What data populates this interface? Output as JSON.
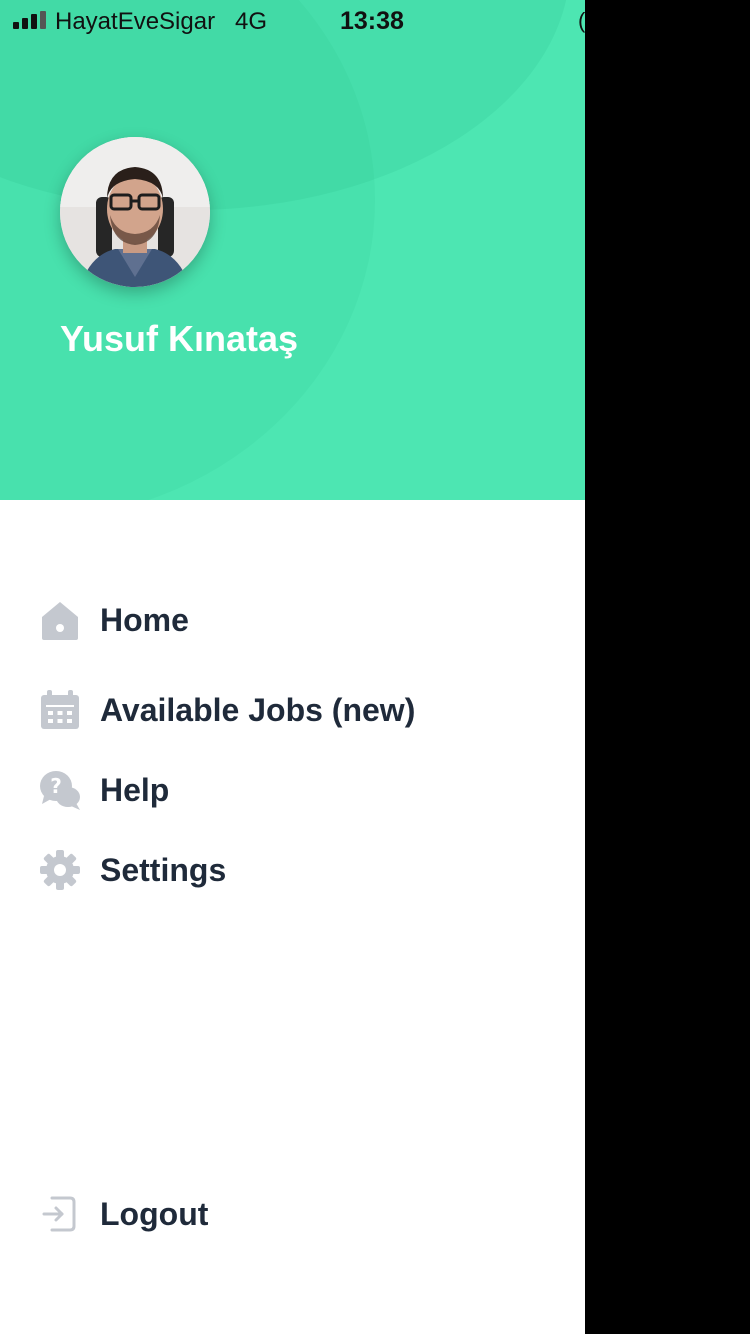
{
  "status_bar": {
    "carrier": "HayatEveSigar",
    "network": "4G",
    "time": "13:38"
  },
  "profile": {
    "name": "Yusuf Kınataş",
    "avatar_icon": "user-photo"
  },
  "menu": {
    "items": [
      {
        "label": "Home",
        "icon": "home-icon"
      },
      {
        "label": "Available Jobs (new)",
        "icon": "calendar-icon"
      },
      {
        "label": "Help",
        "icon": "help-chat-icon"
      },
      {
        "label": "Settings",
        "icon": "gear-icon"
      }
    ],
    "logout": {
      "label": "Logout",
      "icon": "logout-icon"
    }
  },
  "colors": {
    "header_bg": "#4de6b2",
    "text": "#1f2a3a",
    "icon": "#c4c8cf",
    "overlay": "#000000"
  }
}
